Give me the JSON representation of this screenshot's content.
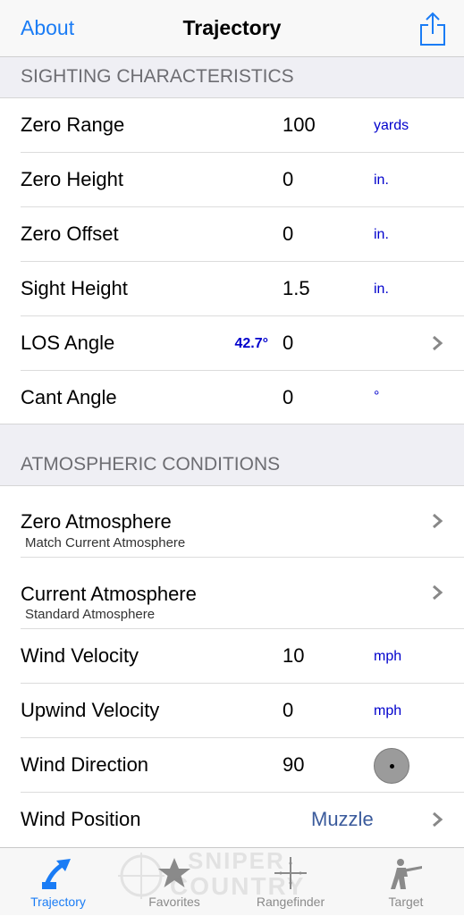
{
  "navbar": {
    "left_link": "About",
    "title": "Trajectory"
  },
  "sections": {
    "sighting": "SIGHTING CHARACTERISTICS",
    "atmospheric": "ATMOSPHERIC CONDITIONS"
  },
  "sighting_rows": {
    "zero_range": {
      "label": "Zero Range",
      "value": "100",
      "unit": "yards"
    },
    "zero_height": {
      "label": "Zero Height",
      "value": "0",
      "unit": "in."
    },
    "zero_offset": {
      "label": "Zero Offset",
      "value": "0",
      "unit": "in."
    },
    "sight_height": {
      "label": "Sight Height",
      "value": "1.5",
      "unit": "in."
    },
    "los_angle": {
      "label": "LOS Angle",
      "badge": "42.7°",
      "value": "0"
    },
    "cant_angle": {
      "label": "Cant Angle",
      "value": "0",
      "unit": "°"
    }
  },
  "atmo_rows": {
    "zero_atmosphere": {
      "label": "Zero Atmosphere",
      "subtitle": "Match Current Atmosphere"
    },
    "current_atmosphere": {
      "label": "Current Atmosphere",
      "subtitle": "Standard Atmosphere"
    },
    "wind_velocity": {
      "label": "Wind Velocity",
      "value": "10",
      "unit": "mph"
    },
    "upwind_velocity": {
      "label": "Upwind Velocity",
      "value": "0",
      "unit": "mph"
    },
    "wind_direction": {
      "label": "Wind Direction",
      "value": "90"
    },
    "wind_position": {
      "label": "Wind Position",
      "value": "Muzzle"
    }
  },
  "tabbar": {
    "trajectory": "Trajectory",
    "favorites": "Favorites",
    "rangefinder": "Rangefinder",
    "target": "Target"
  },
  "watermark": {
    "line1": "SNIPER",
    "line2": "COUNTRY"
  },
  "colors": {
    "accent": "#1a7cf5",
    "unit_blue": "#0000cc",
    "header_bg": "#efeff4"
  },
  "icons": {
    "share": "share-icon",
    "chevron": "chevron-right-icon",
    "trajectory": "trajectory-arrow-icon",
    "favorites": "star-icon",
    "rangefinder": "crosshair-icon",
    "target": "rifleman-icon"
  }
}
